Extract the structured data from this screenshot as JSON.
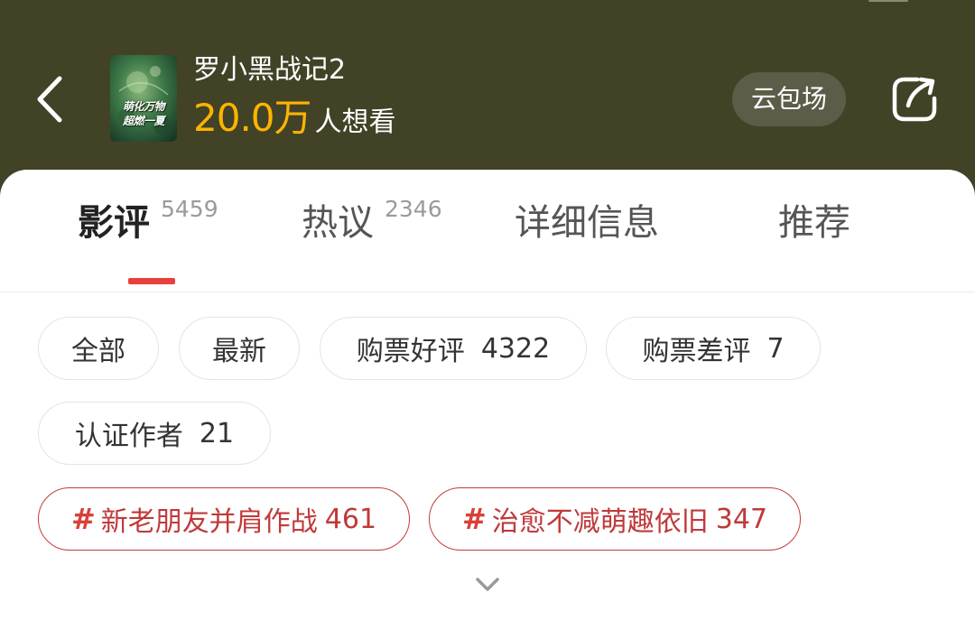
{
  "header": {
    "movie_title": "罗小黑战记2",
    "wish_count": "20.0万",
    "wish_suffix": "人想看",
    "cloud_button": "云包场",
    "poster_line1": "萌化万物",
    "poster_line2": "超燃一夏",
    "accent_color": "#ffb400"
  },
  "tabs": [
    {
      "label": "影评",
      "count": "5459",
      "active": true
    },
    {
      "label": "热议",
      "count": "2346",
      "active": false
    },
    {
      "label": "详细信息",
      "count": "",
      "active": false
    },
    {
      "label": "推荐",
      "count": "",
      "active": false
    }
  ],
  "filters": [
    {
      "label": "全部",
      "count": ""
    },
    {
      "label": "最新",
      "count": ""
    },
    {
      "label": "购票好评",
      "count": "4322"
    },
    {
      "label": "购票差评",
      "count": "7"
    },
    {
      "label": "认证作者",
      "count": "21"
    }
  ],
  "topics": [
    {
      "hash": "#",
      "label": "新老朋友并肩作战",
      "count": "461"
    },
    {
      "hash": "#",
      "label": "治愈不减萌趣依旧",
      "count": "347"
    }
  ],
  "icons": {
    "back": "chevron-left-icon",
    "share": "share-icon",
    "expand": "chevron-down-icon"
  },
  "colors": {
    "header_bg": "#424227",
    "active_tab_indicator": "#e8403a",
    "topic_border": "#c23c3a"
  }
}
